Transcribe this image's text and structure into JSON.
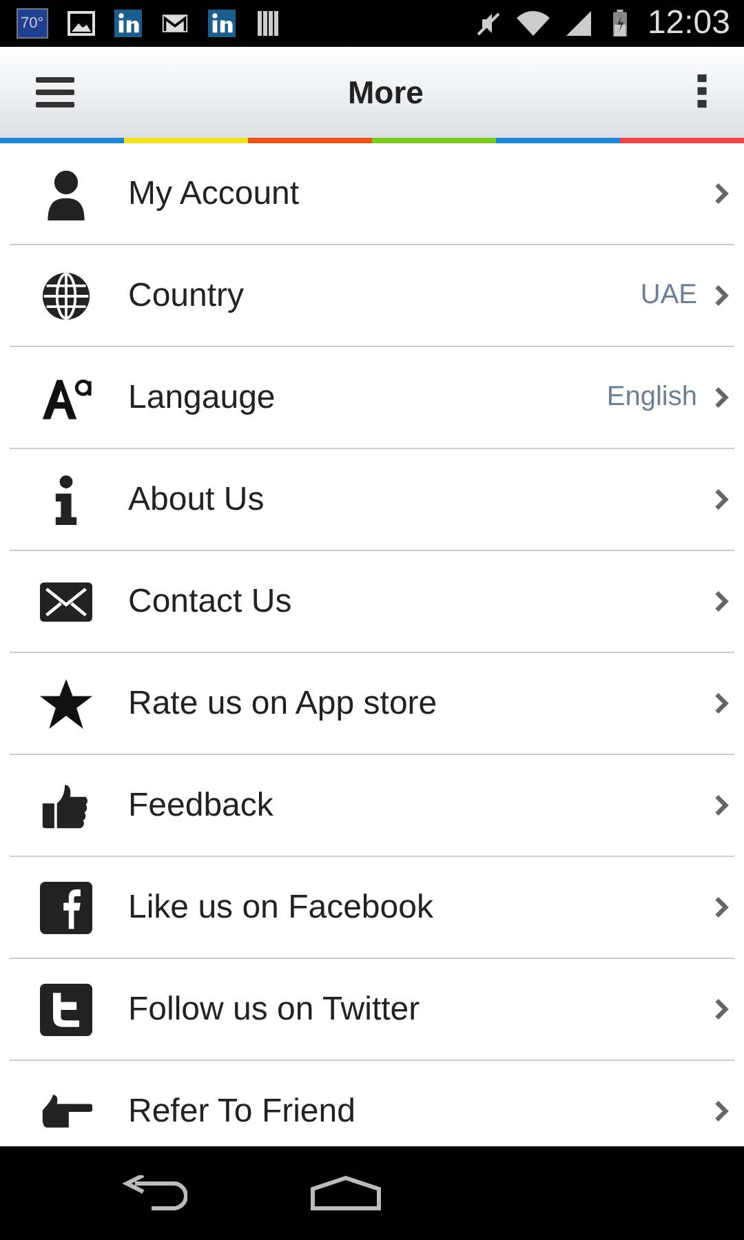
{
  "status_bar": {
    "temperature": "70°",
    "time": "12:03"
  },
  "header": {
    "title": "More"
  },
  "menu": [
    {
      "label": "My Account"
    },
    {
      "label": "Country",
      "value": "UAE"
    },
    {
      "label": "Langauge",
      "value": "English"
    },
    {
      "label": "About Us"
    },
    {
      "label": "Contact Us"
    },
    {
      "label": "Rate us on App store"
    },
    {
      "label": "Feedback"
    },
    {
      "label": "Like us on Facebook"
    },
    {
      "label": "Follow us on Twitter"
    },
    {
      "label": "Refer To Friend"
    }
  ]
}
